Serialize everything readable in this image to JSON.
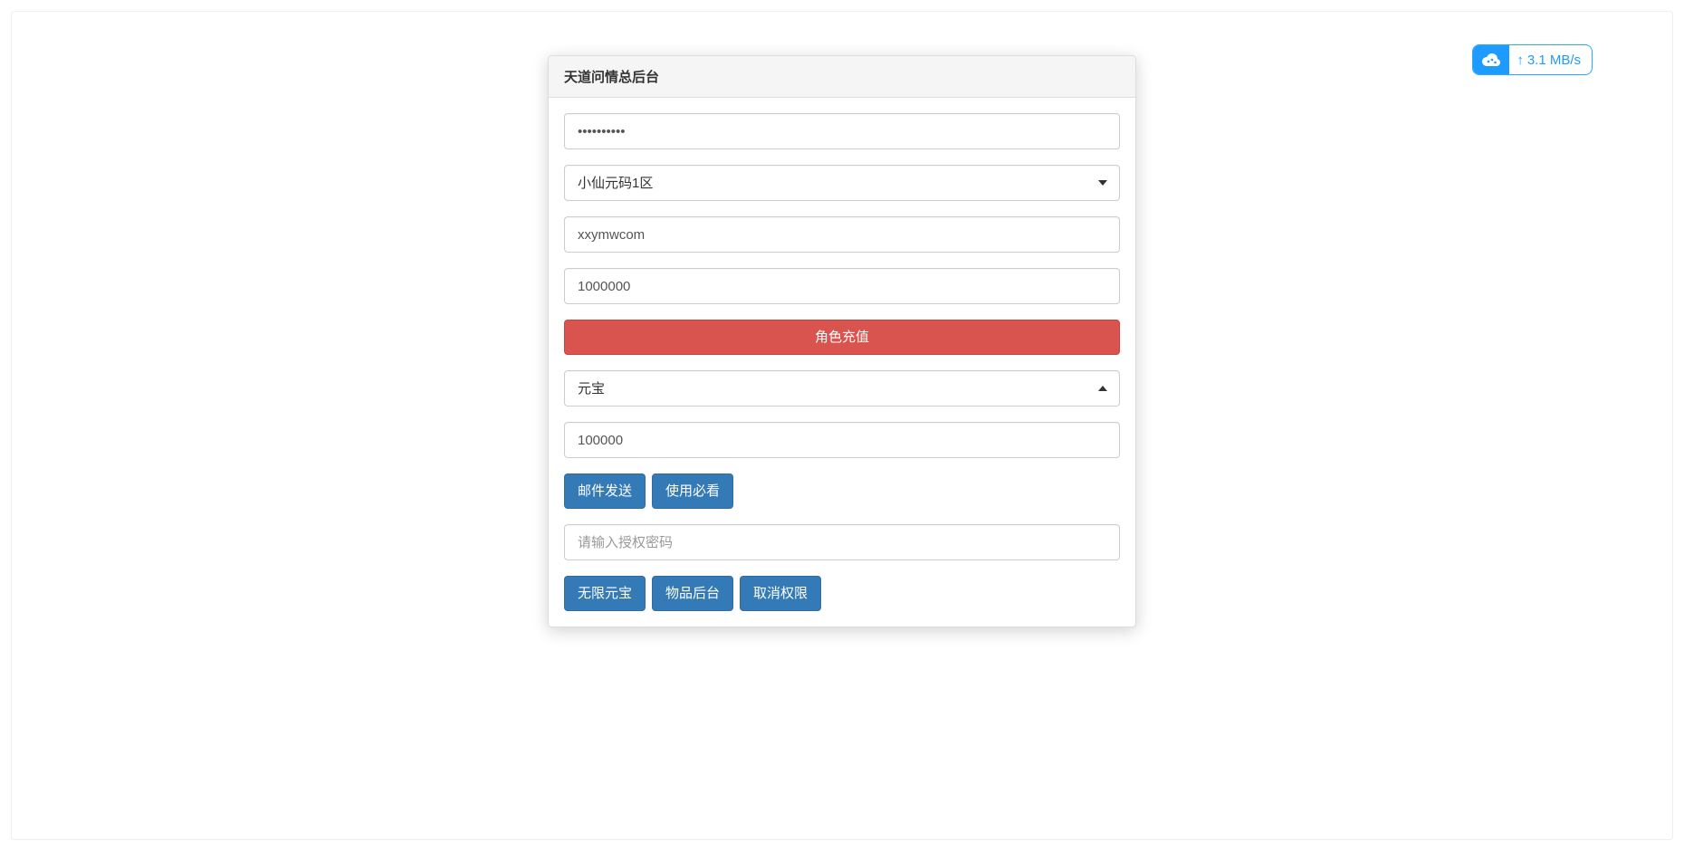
{
  "panel": {
    "title": "天道问情总后台",
    "password_value": "••••••••••",
    "server_select": "小仙元码1区",
    "account_value": "xxymwcom",
    "recharge_amount_value": "1000000",
    "recharge_button": "角色充值",
    "currency_select": "元宝",
    "mail_amount_value": "100000",
    "mail_send_button": "邮件发送",
    "usage_must_read_button": "使用必看",
    "auth_password_placeholder": "请输入授权密码",
    "unlimited_gold_button": "无限元宝",
    "item_backend_button": "物品后台",
    "revoke_permission_button": "取消权限"
  },
  "upload_widget": {
    "speed": "3.1 MB/s"
  }
}
